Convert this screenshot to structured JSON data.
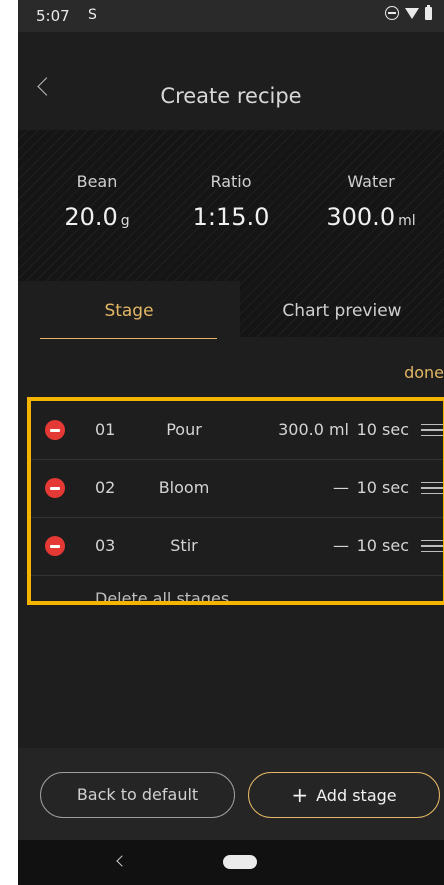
{
  "status_bar": {
    "time": "5:07",
    "app_icon": "S",
    "icons": [
      "do-not-disturb-icon",
      "wifi-icon",
      "battery-icon"
    ]
  },
  "header": {
    "title": "Create recipe",
    "back_icon": "chevron-left-icon"
  },
  "summary": {
    "bean": {
      "label": "Bean",
      "value": "20.0",
      "unit": "g"
    },
    "ratio": {
      "label": "Ratio",
      "value": "1:15.0"
    },
    "water": {
      "label": "Water",
      "value": "300.0",
      "unit": "ml"
    }
  },
  "tabs": {
    "stage": "Stage",
    "chart_preview": "Chart preview",
    "active": "Stage"
  },
  "list": {
    "done_label": "done",
    "stages": [
      {
        "number": "01",
        "name": "Pour",
        "water": "300.0 ml",
        "time": "10 sec"
      },
      {
        "number": "02",
        "name": "Bloom",
        "water": "—",
        "time": "10 sec"
      },
      {
        "number": "03",
        "name": "Stir",
        "water": "—",
        "time": "10 sec"
      }
    ],
    "delete_all_label": "Delete all stages"
  },
  "actions": {
    "back_to_default": "Back to default",
    "add_stage_plus": "+",
    "add_stage": "Add stage"
  },
  "colors": {
    "accent": "#e3b765",
    "highlight_border": "#f5b400",
    "remove": "#e53935",
    "background": "#1e1e1e"
  }
}
